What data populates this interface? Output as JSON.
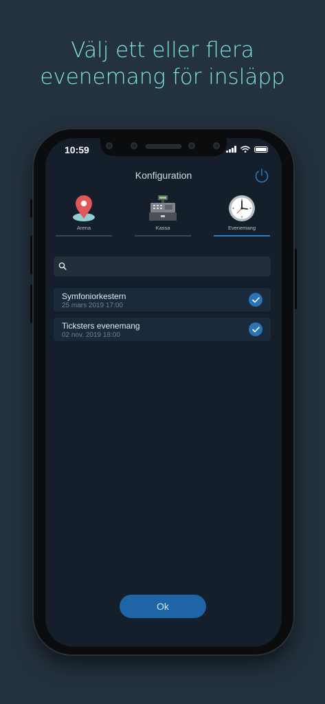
{
  "headline": {
    "line1": "Välj ett eller flera",
    "line2": "evenemang för insläpp"
  },
  "status_bar": {
    "time": "10:59"
  },
  "screen": {
    "title": "Konfiguration"
  },
  "categories": [
    {
      "label": "Arena",
      "icon": "map-pin-icon",
      "active": false
    },
    {
      "label": "Kassa",
      "icon": "cash-register-icon",
      "active": false
    },
    {
      "label": "Evenemang",
      "icon": "clock-icon",
      "active": true
    }
  ],
  "search": {
    "value": "",
    "placeholder": ""
  },
  "events": [
    {
      "title": "Symfoniorkestern",
      "date": "25 mars 2019 17:00",
      "selected": true
    },
    {
      "title": "Ticksters evenemang",
      "date": "02 nov. 2019 18:00",
      "selected": true
    }
  ],
  "ok_button": {
    "label": "Ok"
  },
  "colors": {
    "background": "#24323f",
    "headline": "#7fe3e0",
    "accent": "#2a7fc7",
    "screen": "#141f2b"
  }
}
